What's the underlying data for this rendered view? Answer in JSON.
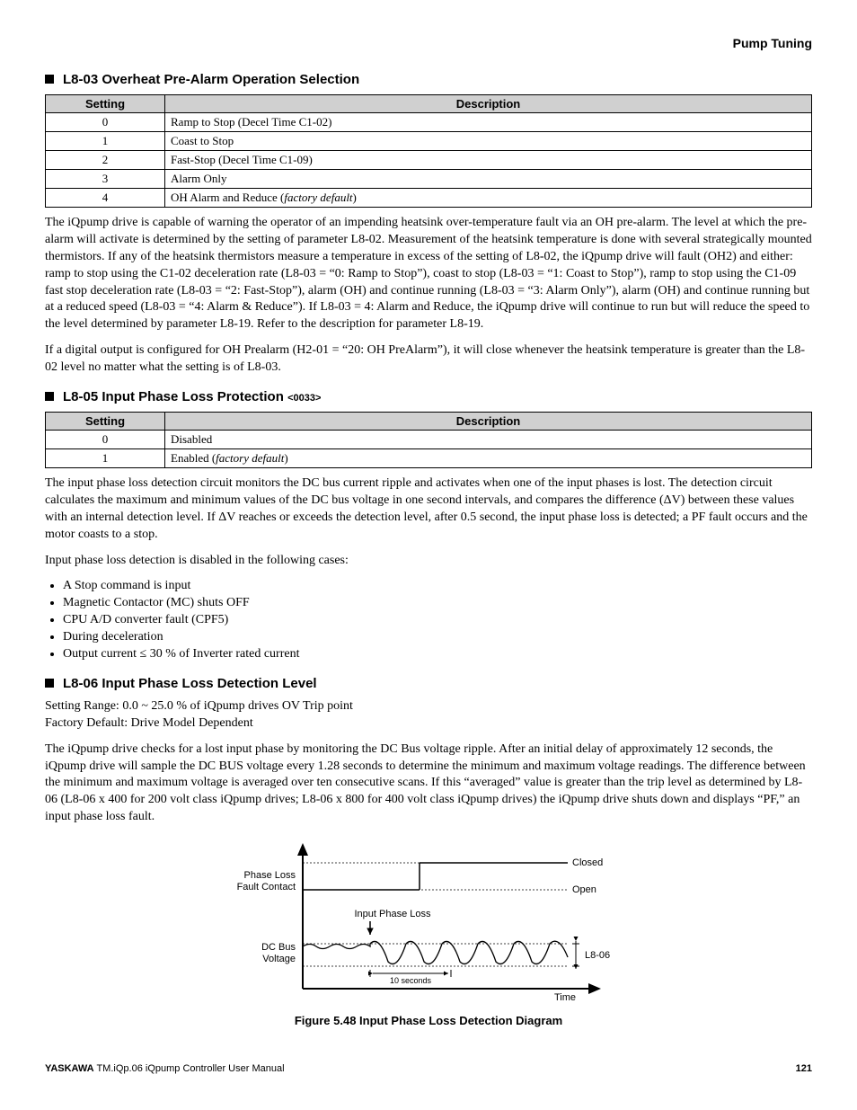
{
  "page_header": "Pump Tuning",
  "sections": {
    "l803": {
      "title": "L8-03 Overheat Pre-Alarm Operation Selection",
      "table": {
        "headers": [
          "Setting",
          "Description"
        ],
        "rows": [
          {
            "setting": "0",
            "desc": "Ramp to Stop (Decel Time C1-02)"
          },
          {
            "setting": "1",
            "desc": "Coast to Stop"
          },
          {
            "setting": "2",
            "desc": "Fast-Stop (Decel Time C1-09)"
          },
          {
            "setting": "3",
            "desc": "Alarm Only"
          },
          {
            "setting": "4",
            "desc_pre": "OH Alarm and Reduce (",
            "desc_italic": "factory default",
            "desc_post": ")"
          }
        ]
      },
      "para1": "The iQpump drive is capable of warning the operator of an impending heatsink over-temperature fault via an OH pre-alarm. The level at which the pre-alarm will activate is determined by the setting of parameter L8-02. Measurement of the heatsink temperature is done with several strategically mounted thermistors. If any of the heatsink thermistors measure a temperature in excess of the setting of L8-02, the iQpump drive will fault (OH2) and either: ramp to stop using the C1-02 deceleration rate (L8-03 = “0: Ramp to Stop”), coast to stop (L8-03 = “1: Coast to Stop”), ramp to stop using the C1-09 fast stop deceleration rate (L8-03 = “2: Fast-Stop”), alarm (OH) and continue running (L8-03 = “3: Alarm Only”), alarm (OH) and continue running but at a reduced speed (L8-03 = “4: Alarm & Reduce”). If L8-03 = 4: Alarm and Reduce, the iQpump drive will continue to run but will reduce the speed to the level determined by parameter L8-19. Refer to the description for parameter L8-19.",
      "para2": "If a digital output is configured for OH Prealarm (H2-01 = “20: OH PreAlarm”), it will close whenever the heatsink temperature is greater than the L8-02 level no matter what the setting is of L8-03."
    },
    "l805": {
      "title": "L8-05 Input Phase Loss Protection",
      "code": "<0033>",
      "table": {
        "headers": [
          "Setting",
          "Description"
        ],
        "rows": [
          {
            "setting": "0",
            "desc": "Disabled"
          },
          {
            "setting": "1",
            "desc_pre": "Enabled (",
            "desc_italic": "factory default",
            "desc_post": ")"
          }
        ]
      },
      "para1": "The input phase loss detection circuit monitors the DC bus current ripple and activates when one of the input phases is lost. The detection circuit calculates the maximum and minimum values of the DC bus voltage in one second intervals, and compares the difference (ΔV) between these values with an internal detection level. If ΔV reaches or exceeds the detection level, after 0.5 second, the input phase loss is detected; a PF fault occurs and the motor coasts to a stop.",
      "para2": "Input phase loss detection is disabled in the following cases:",
      "bullets": [
        "A Stop command is input",
        "Magnetic Contactor (MC) shuts OFF",
        "CPU A/D converter fault (CPF5)",
        "During deceleration",
        "Output current ≤ 30 % of Inverter rated current"
      ]
    },
    "l806": {
      "title": "L8-06 Input Phase Loss Detection Level",
      "range": "Setting Range: 0.0 ~ 25.0 % of iQpump drives OV Trip point",
      "default": "Factory Default: Drive Model Dependent",
      "para1": "The iQpump drive checks for a lost input phase by monitoring the DC Bus voltage ripple. After an initial delay of approximately 12 seconds, the iQpump drive will sample the DC BUS voltage every 1.28 seconds to determine the minimum and maximum voltage readings. The difference between the minimum and maximum voltage is averaged over ten consecutive scans. If this “averaged” value is greater than the trip level as determined by L8-06 (L8-06 x 400 for 200 volt class iQpump drives; L8-06 x 800 for 400 volt class iQpump drives) the iQpump drive shuts down and displays “PF,” an input phase loss fault."
    }
  },
  "figure": {
    "caption": "Figure 5.48  Input Phase Loss Detection Diagram",
    "labels": {
      "phase_loss": "Phase Loss",
      "fault_contact": "Fault Contact",
      "closed": "Closed",
      "open": "Open",
      "input_phase_loss": "Input Phase Loss",
      "dc_bus": "DC Bus",
      "voltage": "Voltage",
      "ten_seconds": "10 seconds",
      "time": "Time",
      "l806": "L8-06"
    }
  },
  "footer": {
    "brand": "YASKAWA",
    "manual": " TM.iQp.06 iQpump Controller User Manual",
    "page": "121"
  }
}
